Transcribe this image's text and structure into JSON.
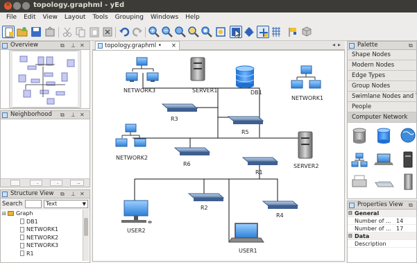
{
  "window": {
    "title": "topology.graphml - yEd",
    "close_glyph": "×"
  },
  "menu": [
    {
      "key": "file",
      "label": "File"
    },
    {
      "key": "edit",
      "label": "Edit"
    },
    {
      "key": "view",
      "label": "View"
    },
    {
      "key": "layout",
      "label": "Layout"
    },
    {
      "key": "tools",
      "label": "Tools"
    },
    {
      "key": "grouping",
      "label": "Grouping"
    },
    {
      "key": "windows",
      "label": "Windows"
    },
    {
      "key": "help",
      "label": "Help"
    }
  ],
  "panels": {
    "overview": {
      "title": "Overview"
    },
    "neighborhood": {
      "title": "Neighborhood",
      "tabs": [
        "",
        ".",
        ".",
        ".."
      ]
    },
    "structure": {
      "title": "Structure View",
      "search_label": "Search",
      "search_value": "",
      "mode_value": "Text",
      "root": "Graph",
      "items": [
        "DB1",
        "NETWORK1",
        "NETWORK2",
        "NETWORK3",
        "R1"
      ]
    },
    "palette": {
      "title": "Palette",
      "sections": [
        "Shape Nodes",
        "Modern Nodes",
        "Edge Types",
        "Group Nodes",
        "Swimlane Nodes and T...",
        "People",
        "Computer Network"
      ],
      "selected": "Computer Network"
    },
    "properties": {
      "title": "Properties View",
      "general_label": "General",
      "rows": [
        {
          "name": "Number of ...",
          "value": "14"
        },
        {
          "name": "Number of ...",
          "value": "17"
        }
      ],
      "data_label": "Data",
      "description_label": "Description"
    }
  },
  "document_tab": {
    "label": "topology.graphml",
    "modified": "•",
    "close": "×"
  },
  "diagram": {
    "nodes": {
      "network3": "NETWORK3",
      "server1": "SERVER1",
      "db1": "DB1",
      "network1": "NETWORK1",
      "r3": "R3",
      "r5": "R5",
      "network2": "NETWORK2",
      "r6": "R6",
      "server2": "SERVER2",
      "r1": "R1",
      "user2": "USER2",
      "r2": "R2",
      "r4": "R4",
      "user1": "USER1"
    }
  }
}
